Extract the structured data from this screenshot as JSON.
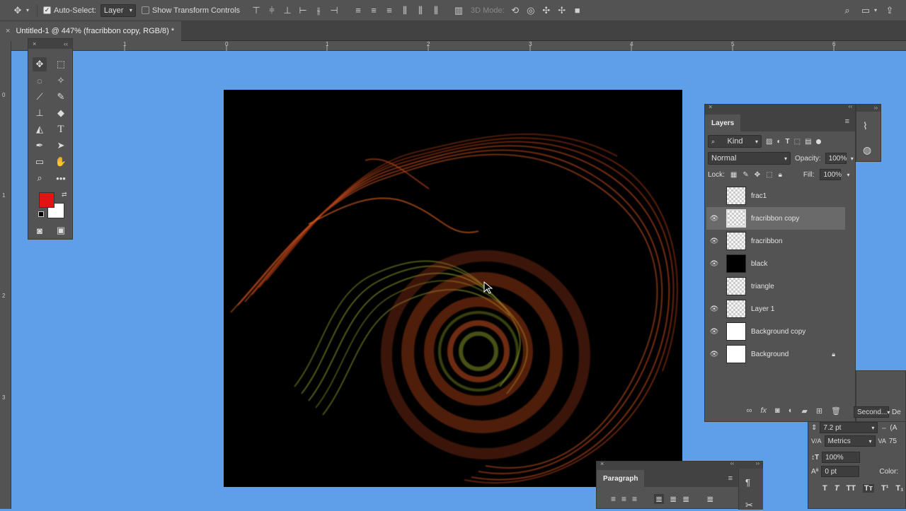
{
  "optionsbar": {
    "auto_select_label": "Auto-Select:",
    "auto_select_value": "Layer",
    "transform_label": "Show Transform Controls",
    "mode3d_label": "3D Mode:"
  },
  "document_tab": {
    "title": "Untitled-1 @ 447% (fracribbon copy, RGB/8) *"
  },
  "ruler": {
    "h_marks": [
      "1",
      "0",
      "1",
      "2",
      "3",
      "4",
      "5",
      "6"
    ],
    "v_marks": [
      "0",
      "1",
      "2",
      "3"
    ]
  },
  "layers_panel": {
    "tab": "Layers",
    "filter_kind": "Kind",
    "blend_mode": "Normal",
    "opacity_label": "Opacity:",
    "opacity_value": "100%",
    "lock_label": "Lock:",
    "fill_label": "Fill:",
    "fill_value": "100%",
    "layers": [
      {
        "name": "frac1",
        "visible": false,
        "selected": false,
        "thumb": "transparent"
      },
      {
        "name": "fracribbon copy",
        "visible": true,
        "selected": true,
        "thumb": "transparent"
      },
      {
        "name": "fracribbon",
        "visible": true,
        "selected": false,
        "thumb": "transparent"
      },
      {
        "name": "black",
        "visible": true,
        "selected": false,
        "thumb": "black"
      },
      {
        "name": "triangle",
        "visible": false,
        "selected": false,
        "thumb": "transparent"
      },
      {
        "name": "Layer 1",
        "visible": true,
        "selected": false,
        "thumb": "transparent"
      },
      {
        "name": "Background copy",
        "visible": true,
        "selected": false,
        "thumb": "white"
      },
      {
        "name": "Background",
        "visible": true,
        "selected": false,
        "thumb": "white",
        "locked": true
      }
    ]
  },
  "character_panel": {
    "font_partial": "Second...",
    "style_partial": "De",
    "leading": "7.2 pt",
    "kerning": "Metrics",
    "vscale": "100%",
    "baseline": "0 pt",
    "color_label": "Color:",
    "tracking_partial": "(A",
    "tracking_val": "75"
  },
  "paragraph_panel": {
    "tab": "Paragraph"
  },
  "colors": {
    "foreground": "#e31313",
    "background": "#ffffff",
    "workspace": "#5f9fea"
  }
}
